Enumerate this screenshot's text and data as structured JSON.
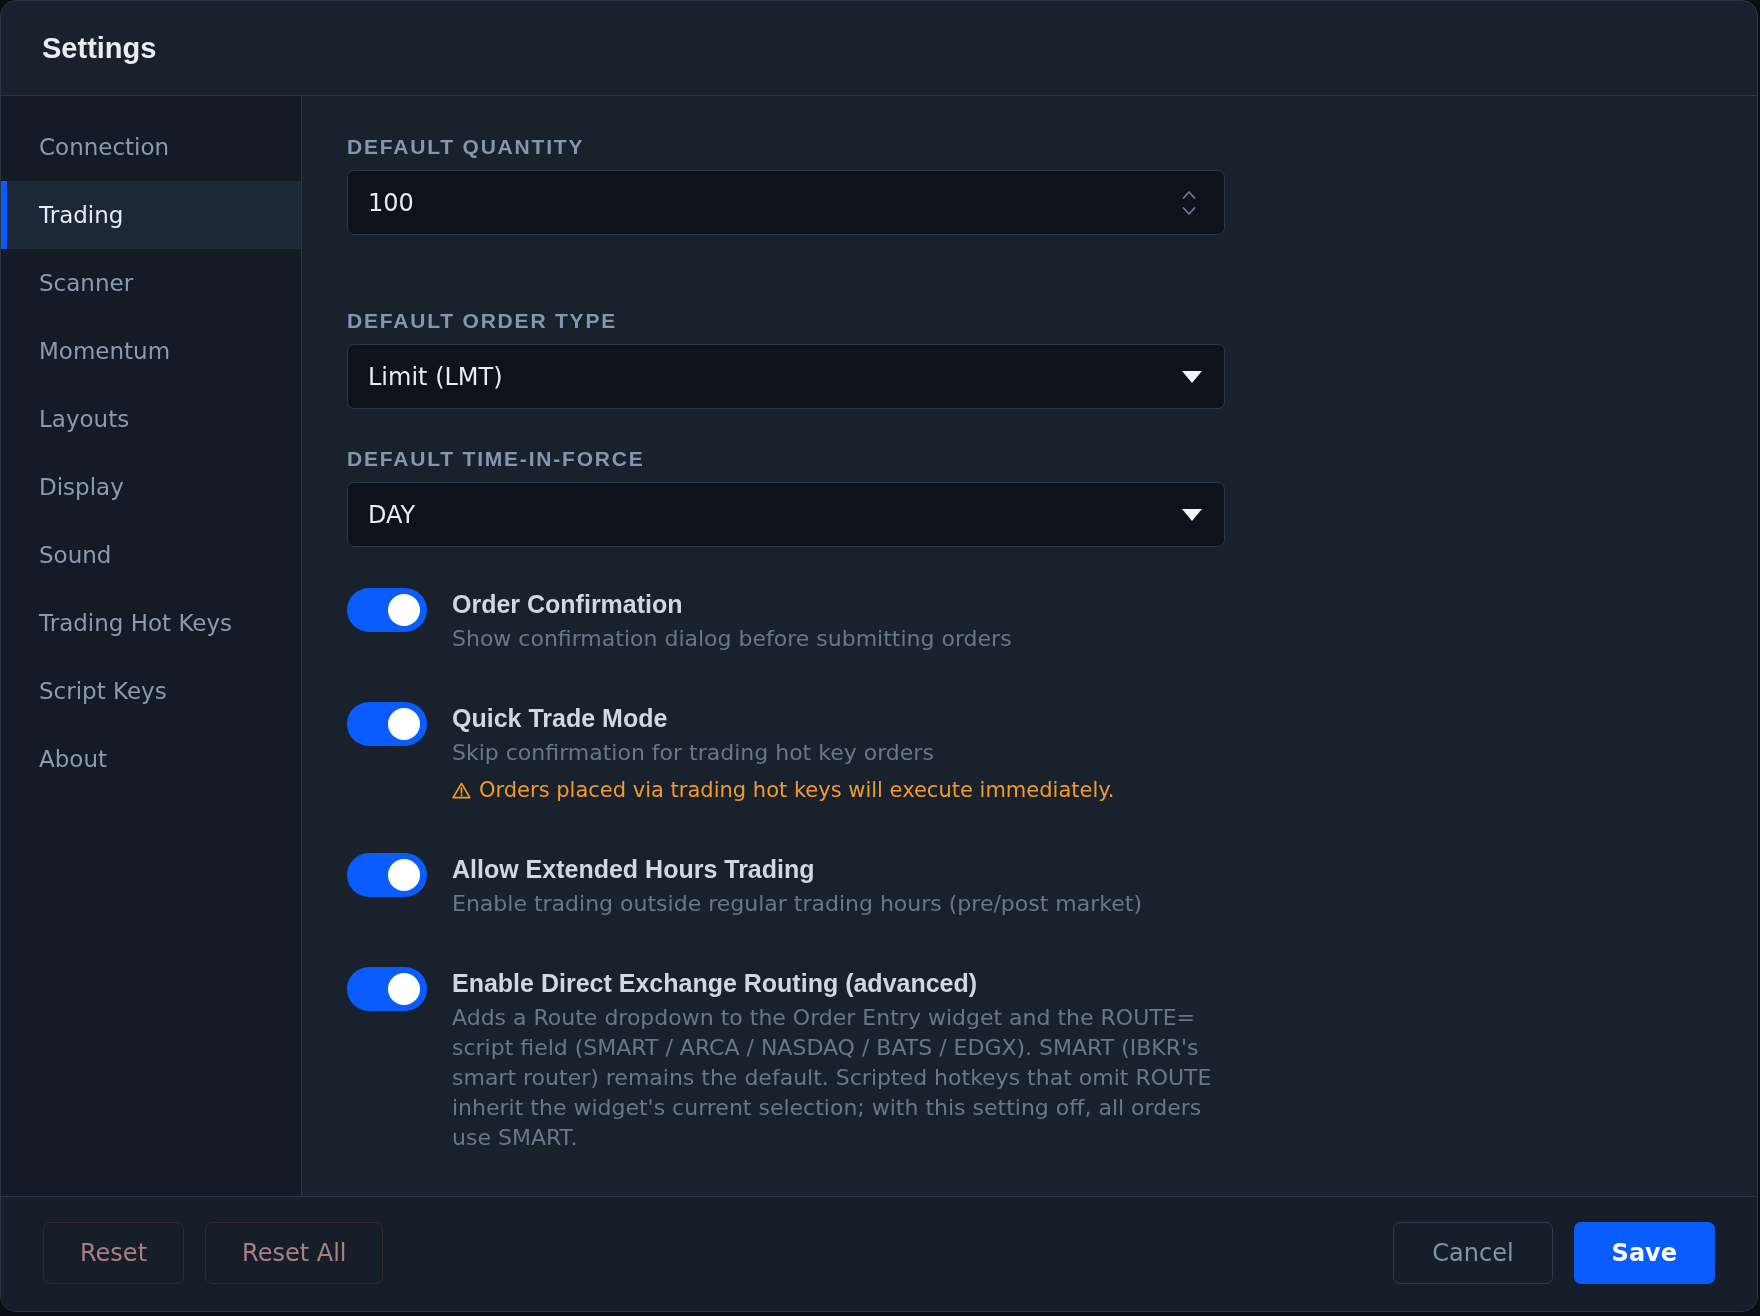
{
  "window": {
    "title": "Settings"
  },
  "sidebar": {
    "items": [
      {
        "label": "Connection",
        "selected": false
      },
      {
        "label": "Trading",
        "selected": true
      },
      {
        "label": "Scanner",
        "selected": false
      },
      {
        "label": "Momentum",
        "selected": false
      },
      {
        "label": "Layouts",
        "selected": false
      },
      {
        "label": "Display",
        "selected": false
      },
      {
        "label": "Sound",
        "selected": false
      },
      {
        "label": "Trading Hot Keys",
        "selected": false
      },
      {
        "label": "Script Keys",
        "selected": false
      },
      {
        "label": "About",
        "selected": false
      }
    ]
  },
  "fields": [
    {
      "kind": "number",
      "label": "DEFAULT QUANTITY",
      "value": "100"
    },
    {
      "kind": "select",
      "label": "DEFAULT ORDER TYPE",
      "value": "Limit (LMT)"
    },
    {
      "kind": "select",
      "label": "DEFAULT TIME-IN-FORCE",
      "value": "DAY"
    }
  ],
  "toggles": [
    {
      "title": "Order Confirmation",
      "description": "Show confirmation dialog before submitting orders",
      "on": true
    },
    {
      "title": "Quick Trade Mode",
      "description": "Skip confirmation for trading hot key orders",
      "on": true,
      "warning": "Orders placed via trading hot keys will execute immediately."
    },
    {
      "title": "Allow Extended Hours Trading",
      "description": "Enable trading outside regular trading hours (pre/post market)",
      "on": true
    },
    {
      "title": "Enable Direct Exchange Routing (advanced)",
      "description": "Adds a Route dropdown to the Order Entry widget and the ROUTE= script field (SMART / ARCA / NASDAQ / BATS / EDGX). SMART (IBKR's smart router) remains the default. Scripted hotkeys that omit ROUTE inherit the widget's current selection; with this setting off, all orders use SMART.",
      "on": true
    }
  ],
  "footer": {
    "left": [
      {
        "label": "Reset",
        "kind": "danger"
      },
      {
        "label": "Reset All",
        "kind": "danger"
      }
    ],
    "right": [
      {
        "label": "Cancel",
        "kind": "secondary"
      },
      {
        "label": "Save",
        "kind": "primary"
      }
    ]
  }
}
